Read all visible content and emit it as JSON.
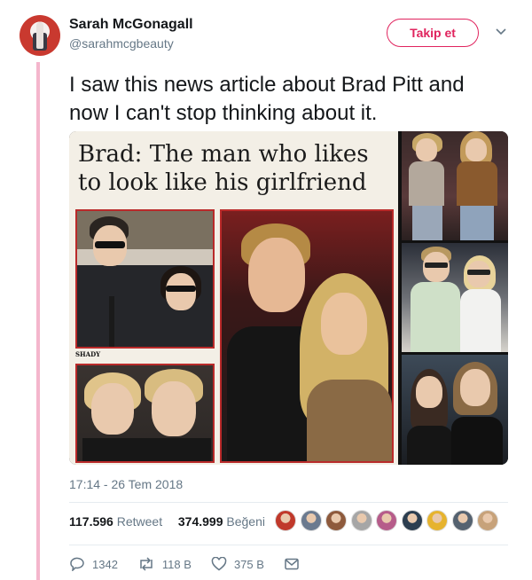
{
  "user": {
    "name": "Sarah McGonagall",
    "handle": "@sarahmcgbeauty"
  },
  "follow_label": "Takip et",
  "tweet_text": "I saw this news article about Brad Pitt and now I can't stop thinking about it.",
  "article": {
    "headline": "Brad: The man who likes to look like his girlfriend",
    "caption_label": "SHADY"
  },
  "timestamp": "17:14 - 26 Tem 2018",
  "stats": {
    "retweets": "117.596",
    "retweets_label": "Retweet",
    "likes": "374.999",
    "likes_label": "Beğeni"
  },
  "likers": [
    "#c0392b",
    "#6b7a8f",
    "#8e5a3c",
    "#a6a6a6",
    "#b65c8a",
    "#2c3e50",
    "#e6b32e",
    "#556270",
    "#c7a27a"
  ],
  "actions": {
    "replies": "1342",
    "retweets": "118 B",
    "likes": "375 B"
  },
  "colors": {
    "accent": "#e0245e",
    "thread_bar": "#f4b6cc",
    "meta": "#657786"
  }
}
